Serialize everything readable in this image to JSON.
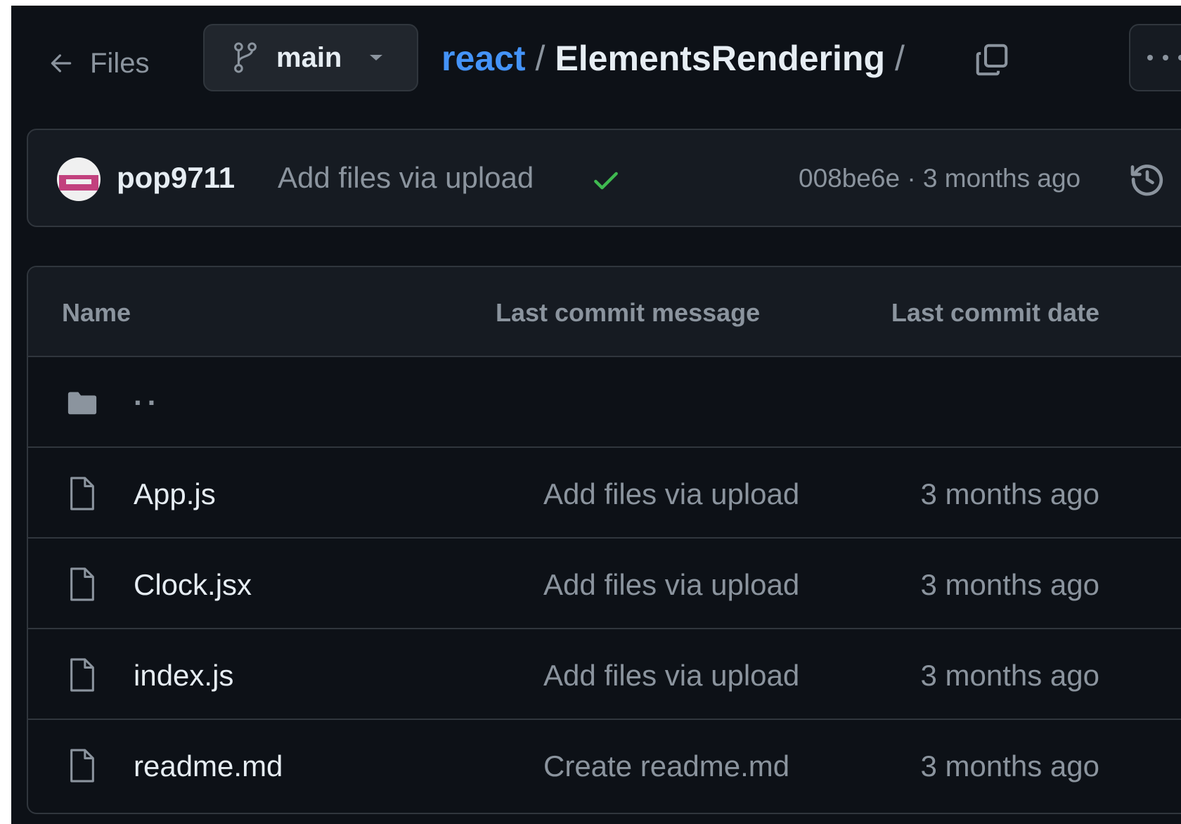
{
  "header": {
    "back_label": "Files",
    "branch": "main",
    "breadcrumb": {
      "repo": "react",
      "separator": "/",
      "folder": "ElementsRendering",
      "trailing": "/"
    }
  },
  "commit": {
    "author": "pop9711",
    "message": "Add files via upload",
    "status_icon": "check-icon",
    "meta": "008be6e · 3 months ago"
  },
  "table": {
    "columns": [
      "Name",
      "Last commit message",
      "Last commit date"
    ],
    "parent_label": "..",
    "rows": [
      {
        "name": "App.js",
        "message": "Add files via upload",
        "date": "3 months ago"
      },
      {
        "name": "Clock.jsx",
        "message": "Add files via upload",
        "date": "3 months ago"
      },
      {
        "name": "index.js",
        "message": "Add files via upload",
        "date": "3 months ago"
      },
      {
        "name": "readme.md",
        "message": "Create readme.md",
        "date": "3 months ago"
      }
    ]
  },
  "colors": {
    "background": "#0d1117",
    "panel": "#161b22",
    "border": "#30363d",
    "link": "#4493f8",
    "text": "#e6edf3",
    "muted": "#8b949e",
    "success": "#3fb950"
  }
}
